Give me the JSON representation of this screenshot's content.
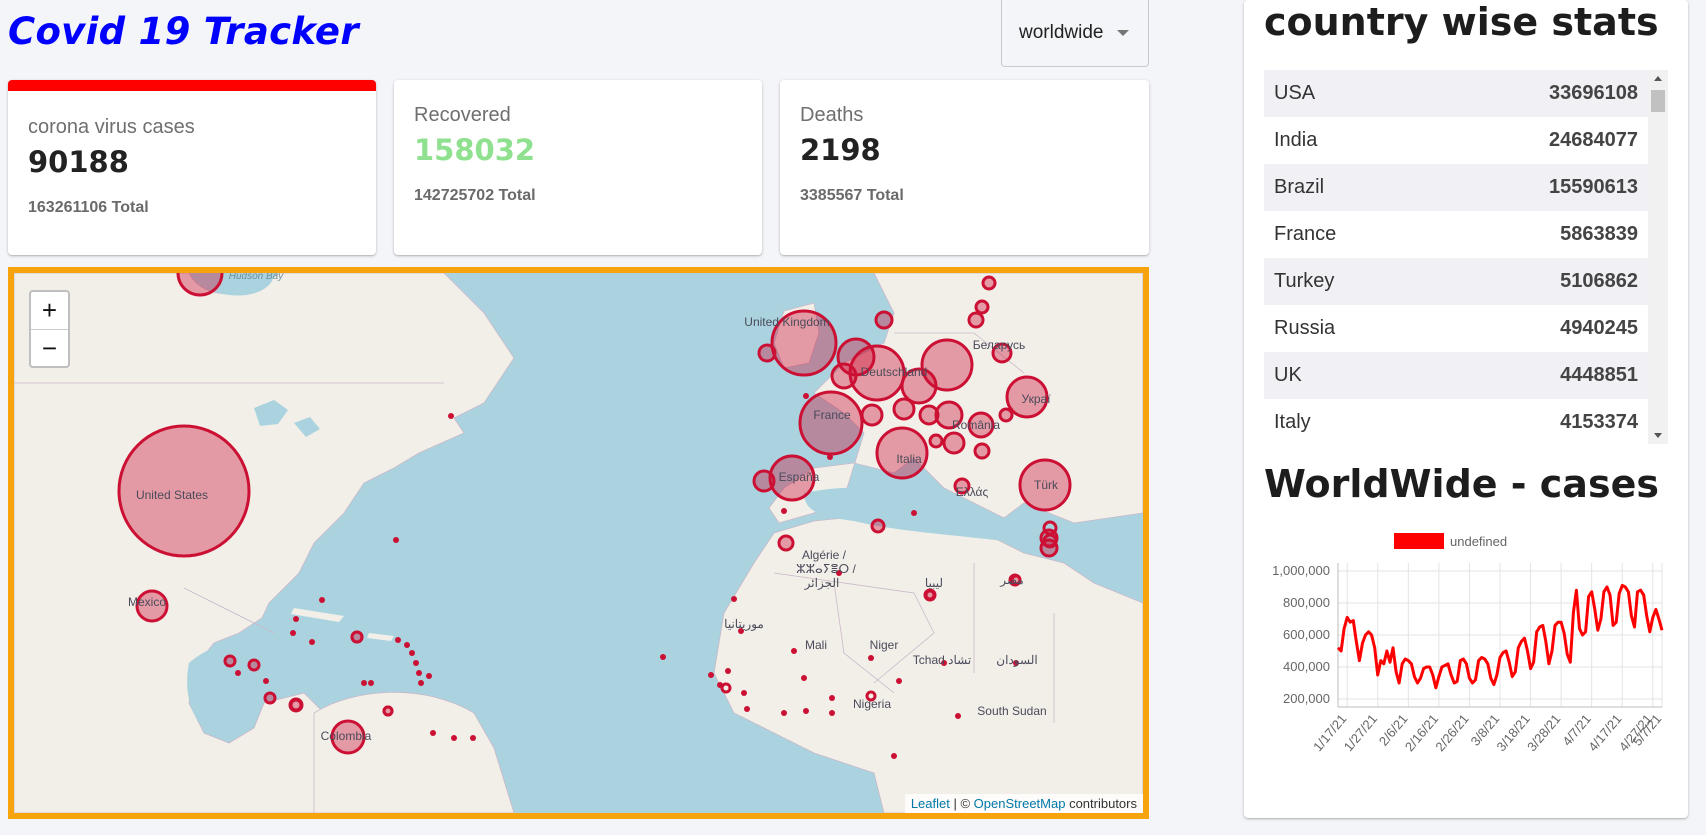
{
  "app": {
    "title": "Covid 19 Tracker"
  },
  "country_select": {
    "value": "worldwide"
  },
  "cards": [
    {
      "label": "corona virus cases",
      "value": "90188",
      "total": "163261106 Total"
    },
    {
      "label": "Recovered",
      "value": "158032",
      "total": "142725702 Total"
    },
    {
      "label": "Deaths",
      "value": "2198",
      "total": "3385567 Total"
    }
  ],
  "map": {
    "zoom_in": "+",
    "zoom_out": "−",
    "attribution": {
      "leaflet": "Leaflet",
      "sep": " | © ",
      "osm": "OpenStreetMap",
      "contributors": " contributors"
    },
    "labels": {
      "united_states": "United States",
      "mexico": "Mexico",
      "colombia": "Colombia",
      "united_kingdom": "United Kingdom",
      "france": "France",
      "espana": "España",
      "italia": "Italia",
      "deutschland": "Deutschland",
      "romania": "România",
      "belarus": "Беларусь",
      "ukraine": "Украї",
      "turkiye": "Türk",
      "ellas": "Ελλάς",
      "algerie1": "Algérie /",
      "algerie2": "ⵣⵣⴰⵢⴻⵔ /",
      "algerie3": "الجزائر",
      "libya": "ليبيا",
      "egypt": "مصر",
      "mauritania": "موريتانيا",
      "mali": "Mali",
      "niger": "Niger",
      "tchad": "Tchad تشاد",
      "sudan": "السودان",
      "nigeria": "Nigeria",
      "south_sudan": "South Sudan",
      "hudson_bay": "Hudson Bay"
    }
  },
  "stats_panel": {
    "title": "country wise stats",
    "rows": [
      {
        "country": "USA",
        "cases": "33696108"
      },
      {
        "country": "India",
        "cases": "24684077"
      },
      {
        "country": "Brazil",
        "cases": "15590613"
      },
      {
        "country": "France",
        "cases": "5863839"
      },
      {
        "country": "Turkey",
        "cases": "5106862"
      },
      {
        "country": "Russia",
        "cases": "4940245"
      },
      {
        "country": "UK",
        "cases": "4448851"
      },
      {
        "country": "Italy",
        "cases": "4153374"
      }
    ]
  },
  "chart_title": "WorldWide - cases",
  "colors": {
    "accent": "#ff0000",
    "map_border": "#f7a30e",
    "circle": "#cc1034",
    "title": "#0000ff"
  },
  "chart_data": {
    "type": "line",
    "title": "",
    "legend": [
      "undefined"
    ],
    "legend_position": "top",
    "grid": true,
    "ylim": [
      150000,
      1050000
    ],
    "yticks": [
      "1,000,000",
      "800,000",
      "600,000",
      "400,000",
      "200,000"
    ],
    "xticks": [
      "1/17/21",
      "1/27/21",
      "2/6/21",
      "2/16/21",
      "2/26/21",
      "3/8/21",
      "3/18/21",
      "3/28/21",
      "4/7/21",
      "4/17/21",
      "4/27/21",
      "5/7/21"
    ],
    "series": [
      {
        "name": "undefined",
        "color": "#ff0000",
        "x_start": "1/14/21",
        "values": [
          520000,
          500000,
          640000,
          710000,
          680000,
          690000,
          560000,
          440000,
          550000,
          600000,
          620000,
          600000,
          520000,
          350000,
          440000,
          420000,
          500000,
          430000,
          520000,
          370000,
          300000,
          420000,
          450000,
          440000,
          420000,
          340000,
          300000,
          330000,
          390000,
          400000,
          400000,
          350000,
          270000,
          340000,
          400000,
          410000,
          420000,
          350000,
          300000,
          310000,
          440000,
          450000,
          420000,
          330000,
          300000,
          320000,
          440000,
          460000,
          450000,
          420000,
          330000,
          290000,
          350000,
          460000,
          490000,
          500000,
          430000,
          340000,
          370000,
          520000,
          560000,
          580000,
          500000,
          390000,
          430000,
          620000,
          650000,
          660000,
          560000,
          420000,
          500000,
          660000,
          680000,
          680000,
          610000,
          480000,
          430000,
          740000,
          880000,
          640000,
          600000,
          620000,
          840000,
          870000,
          760000,
          630000,
          700000,
          870000,
          900000,
          850000,
          660000,
          680000,
          860000,
          910000,
          900000,
          870000,
          720000,
          650000,
          870000,
          880000,
          850000,
          720000,
          620000,
          710000,
          760000,
          700000,
          630000
        ]
      }
    ]
  }
}
